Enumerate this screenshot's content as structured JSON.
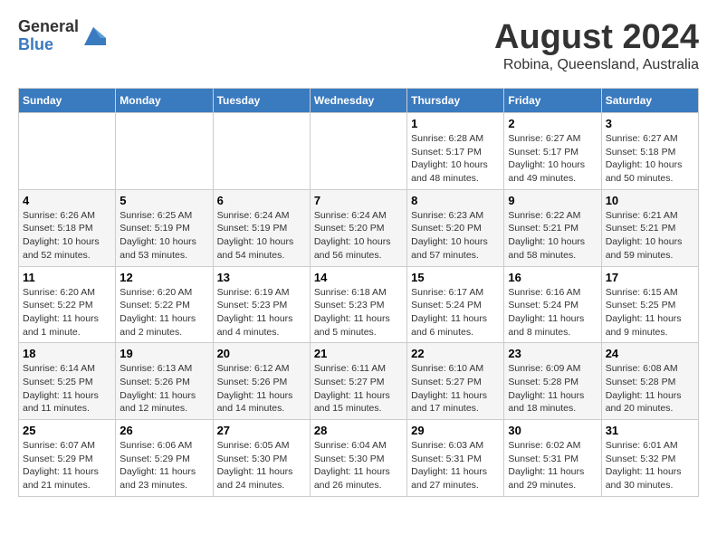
{
  "logo": {
    "general": "General",
    "blue": "Blue"
  },
  "title": "August 2024",
  "subtitle": "Robina, Queensland, Australia",
  "days_of_week": [
    "Sunday",
    "Monday",
    "Tuesday",
    "Wednesday",
    "Thursday",
    "Friday",
    "Saturday"
  ],
  "weeks": [
    [
      {
        "day": "",
        "info": ""
      },
      {
        "day": "",
        "info": ""
      },
      {
        "day": "",
        "info": ""
      },
      {
        "day": "",
        "info": ""
      },
      {
        "day": "1",
        "info": "Sunrise: 6:28 AM\nSunset: 5:17 PM\nDaylight: 10 hours and 48 minutes."
      },
      {
        "day": "2",
        "info": "Sunrise: 6:27 AM\nSunset: 5:17 PM\nDaylight: 10 hours and 49 minutes."
      },
      {
        "day": "3",
        "info": "Sunrise: 6:27 AM\nSunset: 5:18 PM\nDaylight: 10 hours and 50 minutes."
      }
    ],
    [
      {
        "day": "4",
        "info": "Sunrise: 6:26 AM\nSunset: 5:18 PM\nDaylight: 10 hours and 52 minutes."
      },
      {
        "day": "5",
        "info": "Sunrise: 6:25 AM\nSunset: 5:19 PM\nDaylight: 10 hours and 53 minutes."
      },
      {
        "day": "6",
        "info": "Sunrise: 6:24 AM\nSunset: 5:19 PM\nDaylight: 10 hours and 54 minutes."
      },
      {
        "day": "7",
        "info": "Sunrise: 6:24 AM\nSunset: 5:20 PM\nDaylight: 10 hours and 56 minutes."
      },
      {
        "day": "8",
        "info": "Sunrise: 6:23 AM\nSunset: 5:20 PM\nDaylight: 10 hours and 57 minutes."
      },
      {
        "day": "9",
        "info": "Sunrise: 6:22 AM\nSunset: 5:21 PM\nDaylight: 10 hours and 58 minutes."
      },
      {
        "day": "10",
        "info": "Sunrise: 6:21 AM\nSunset: 5:21 PM\nDaylight: 10 hours and 59 minutes."
      }
    ],
    [
      {
        "day": "11",
        "info": "Sunrise: 6:20 AM\nSunset: 5:22 PM\nDaylight: 11 hours and 1 minute."
      },
      {
        "day": "12",
        "info": "Sunrise: 6:20 AM\nSunset: 5:22 PM\nDaylight: 11 hours and 2 minutes."
      },
      {
        "day": "13",
        "info": "Sunrise: 6:19 AM\nSunset: 5:23 PM\nDaylight: 11 hours and 4 minutes."
      },
      {
        "day": "14",
        "info": "Sunrise: 6:18 AM\nSunset: 5:23 PM\nDaylight: 11 hours and 5 minutes."
      },
      {
        "day": "15",
        "info": "Sunrise: 6:17 AM\nSunset: 5:24 PM\nDaylight: 11 hours and 6 minutes."
      },
      {
        "day": "16",
        "info": "Sunrise: 6:16 AM\nSunset: 5:24 PM\nDaylight: 11 hours and 8 minutes."
      },
      {
        "day": "17",
        "info": "Sunrise: 6:15 AM\nSunset: 5:25 PM\nDaylight: 11 hours and 9 minutes."
      }
    ],
    [
      {
        "day": "18",
        "info": "Sunrise: 6:14 AM\nSunset: 5:25 PM\nDaylight: 11 hours and 11 minutes."
      },
      {
        "day": "19",
        "info": "Sunrise: 6:13 AM\nSunset: 5:26 PM\nDaylight: 11 hours and 12 minutes."
      },
      {
        "day": "20",
        "info": "Sunrise: 6:12 AM\nSunset: 5:26 PM\nDaylight: 11 hours and 14 minutes."
      },
      {
        "day": "21",
        "info": "Sunrise: 6:11 AM\nSunset: 5:27 PM\nDaylight: 11 hours and 15 minutes."
      },
      {
        "day": "22",
        "info": "Sunrise: 6:10 AM\nSunset: 5:27 PM\nDaylight: 11 hours and 17 minutes."
      },
      {
        "day": "23",
        "info": "Sunrise: 6:09 AM\nSunset: 5:28 PM\nDaylight: 11 hours and 18 minutes."
      },
      {
        "day": "24",
        "info": "Sunrise: 6:08 AM\nSunset: 5:28 PM\nDaylight: 11 hours and 20 minutes."
      }
    ],
    [
      {
        "day": "25",
        "info": "Sunrise: 6:07 AM\nSunset: 5:29 PM\nDaylight: 11 hours and 21 minutes."
      },
      {
        "day": "26",
        "info": "Sunrise: 6:06 AM\nSunset: 5:29 PM\nDaylight: 11 hours and 23 minutes."
      },
      {
        "day": "27",
        "info": "Sunrise: 6:05 AM\nSunset: 5:30 PM\nDaylight: 11 hours and 24 minutes."
      },
      {
        "day": "28",
        "info": "Sunrise: 6:04 AM\nSunset: 5:30 PM\nDaylight: 11 hours and 26 minutes."
      },
      {
        "day": "29",
        "info": "Sunrise: 6:03 AM\nSunset: 5:31 PM\nDaylight: 11 hours and 27 minutes."
      },
      {
        "day": "30",
        "info": "Sunrise: 6:02 AM\nSunset: 5:31 PM\nDaylight: 11 hours and 29 minutes."
      },
      {
        "day": "31",
        "info": "Sunrise: 6:01 AM\nSunset: 5:32 PM\nDaylight: 11 hours and 30 minutes."
      }
    ]
  ]
}
